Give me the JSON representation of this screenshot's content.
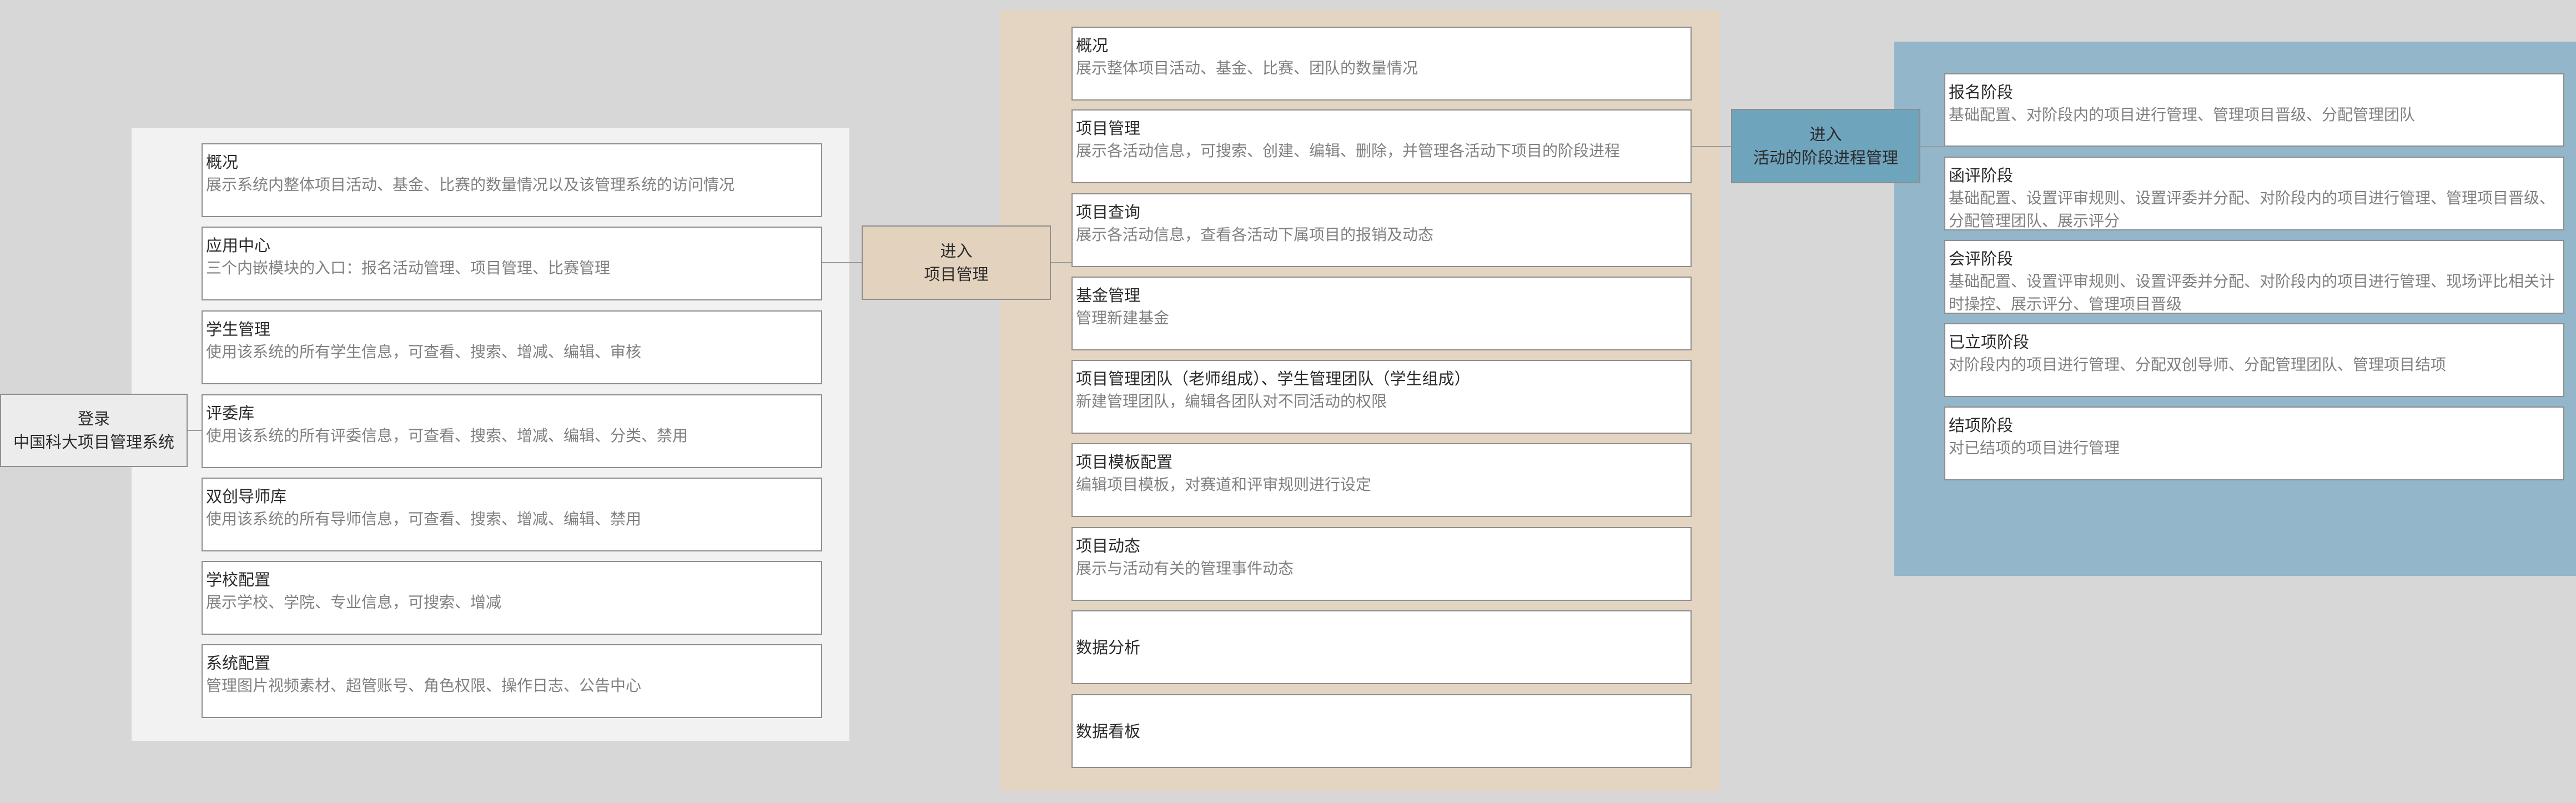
{
  "login": {
    "line1": "登录",
    "line2": "中国科大项目管理系统"
  },
  "enter_project_mgmt": {
    "line1": "进入",
    "line2": "项目管理"
  },
  "enter_stage_mgmt": {
    "line1": "进入",
    "line2": "活动的阶段进程管理"
  },
  "system_modules": [
    {
      "title": "概况",
      "desc": "展示系统内整体项目活动、基金、比赛的数量情况以及该管理系统的访问情况"
    },
    {
      "title": "应用中心",
      "desc": "三个内嵌模块的入口：报名活动管理、项目管理、比赛管理"
    },
    {
      "title": "学生管理",
      "desc": "使用该系统的所有学生信息，可查看、搜索、增减、编辑、审核"
    },
    {
      "title": "评委库",
      "desc": "使用该系统的所有评委信息，可查看、搜索、增减、编辑、分类、禁用"
    },
    {
      "title": "双创导师库",
      "desc": "使用该系统的所有导师信息，可查看、搜索、增减、编辑、禁用"
    },
    {
      "title": "学校配置",
      "desc": "展示学校、学院、专业信息，可搜索、增减"
    },
    {
      "title": "系统配置",
      "desc": "管理图片视频素材、超管账号、角色权限、操作日志、公告中心"
    }
  ],
  "project_modules": [
    {
      "title": "概况",
      "desc": "展示整体项目活动、基金、比赛、团队的数量情况"
    },
    {
      "title": "项目管理",
      "desc": "展示各活动信息，可搜索、创建、编辑、删除，并管理各活动下项目的阶段进程"
    },
    {
      "title": "项目查询",
      "desc": "展示各活动信息，查看各活动下属项目的报销及动态"
    },
    {
      "title": "基金管理",
      "desc": "管理新建基金"
    },
    {
      "title": "项目管理团队（老师组成）、学生管理团队（学生组成）",
      "desc": "新建管理团队，编辑各团队对不同活动的权限"
    },
    {
      "title": "项目模板配置",
      "desc": "编辑项目模板，对赛道和评审规则进行设定"
    },
    {
      "title": "项目动态",
      "desc": "展示与活动有关的管理事件动态"
    },
    {
      "title": "数据分析",
      "desc": ""
    },
    {
      "title": "数据看板",
      "desc": ""
    }
  ],
  "stages": [
    {
      "title": "报名阶段",
      "desc": "基础配置、对阶段内的项目进行管理、管理项目晋级、分配管理团队"
    },
    {
      "title": "函评阶段",
      "desc": "基础配置、设置评审规则、设置评委并分配、对阶段内的项目进行管理、管理项目晋级、分配管理团队、展示评分"
    },
    {
      "title": "会评阶段",
      "desc": "基础配置、设置评审规则、设置评委并分配、对阶段内的项目进行管理、现场评比相关计时操控、展示评分、管理项目晋级"
    },
    {
      "title": "已立项阶段",
      "desc": "对阶段内的项目进行管理、分配双创导师、分配管理团队、管理项目结项"
    },
    {
      "title": "结项阶段",
      "desc": "对已结项的项目进行管理"
    }
  ]
}
